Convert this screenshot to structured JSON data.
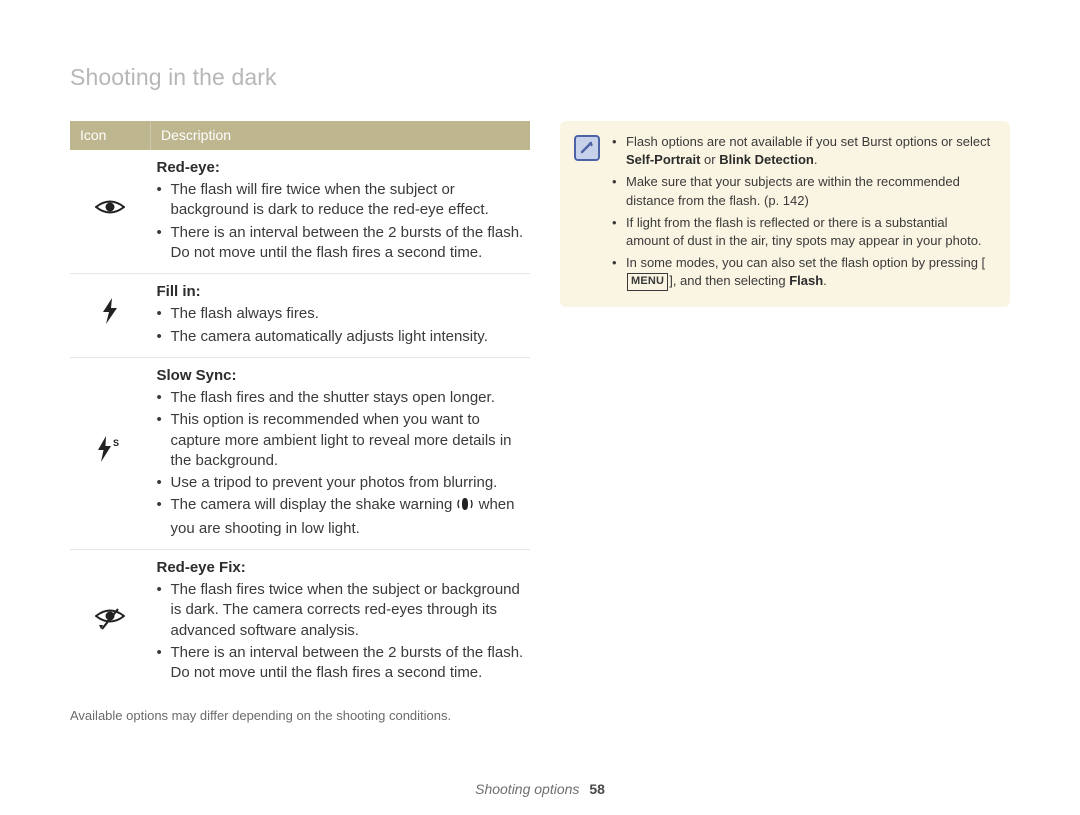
{
  "page_title": "Shooting in the dark",
  "table": {
    "header": {
      "icon": "Icon",
      "desc": "Description"
    },
    "rows": [
      {
        "icon_name": "red-eye-icon",
        "title": "Red-eye",
        "bullets": [
          "The flash will fire twice when the subject or background is dark to reduce the red-eye effect.",
          "There is an interval between the 2 bursts of the flash. Do not move until the flash fires a second time."
        ]
      },
      {
        "icon_name": "fill-in-flash-icon",
        "title": "Fill in",
        "bullets": [
          "The flash always fires.",
          "The camera automatically adjusts light intensity."
        ]
      },
      {
        "icon_name": "slow-sync-flash-icon",
        "title": "Slow Sync",
        "bullets": [
          "The flash fires and the shutter stays open longer.",
          "This option is recommended when you want to capture more ambient light to reveal more details in the background.",
          "Use a tripod to prevent your photos from blurring.",
          {
            "pre": "The camera will display the shake warning ",
            "icon": "shake-warning-icon",
            "post": " when you are shooting in low light."
          }
        ]
      },
      {
        "icon_name": "red-eye-fix-icon",
        "title": "Red-eye Fix",
        "bullets": [
          "The flash fires twice when the subject or background is dark. The camera corrects red-eyes through its advanced software analysis.",
          "There is an interval between the 2 bursts of the flash. Do not move until the flash fires a second time."
        ]
      }
    ]
  },
  "footnote": "Available options may differ depending on the shooting conditions.",
  "note": {
    "items": [
      {
        "pre": "Flash options are not available if you set Burst options or select ",
        "bold1": "Self-Portrait",
        "mid": " or ",
        "bold2": "Blink Detection",
        "post": "."
      },
      {
        "text": "Make sure that your subjects are within the recommended distance from the flash. (p. 142)"
      },
      {
        "text": "If light from the flash is reflected or there is a substantial amount of dust in the air, tiny spots may appear in your photo."
      },
      {
        "pre": "In some modes, you can also set the flash option by pressing [",
        "menu": "MENU",
        "mid": "], and then selecting ",
        "bold1": "Flash",
        "post": "."
      }
    ]
  },
  "footer": {
    "section": "Shooting options",
    "page": "58"
  }
}
